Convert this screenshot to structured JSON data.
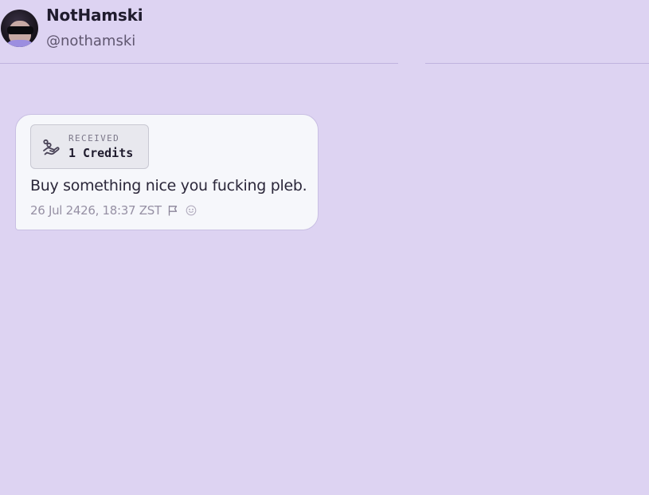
{
  "profile": {
    "display_name": "NotHamski",
    "handle": "@nothamski",
    "avatar": "user-avatar-photo"
  },
  "message": {
    "credit": {
      "label": "RECEIVED",
      "value": "1 Credits",
      "icon": "hand-coins-icon"
    },
    "text": "Buy something nice you fucking pleb.",
    "timestamp": "26 Jul 2426, 18:37 ZST",
    "actions": [
      {
        "icon": "flag-icon"
      },
      {
        "icon": "smile-icon"
      }
    ]
  },
  "colors": {
    "background": "#ddd3f2",
    "card": "#f6f7fb",
    "text": "#1f1b2d",
    "muted": "#9690a4"
  }
}
